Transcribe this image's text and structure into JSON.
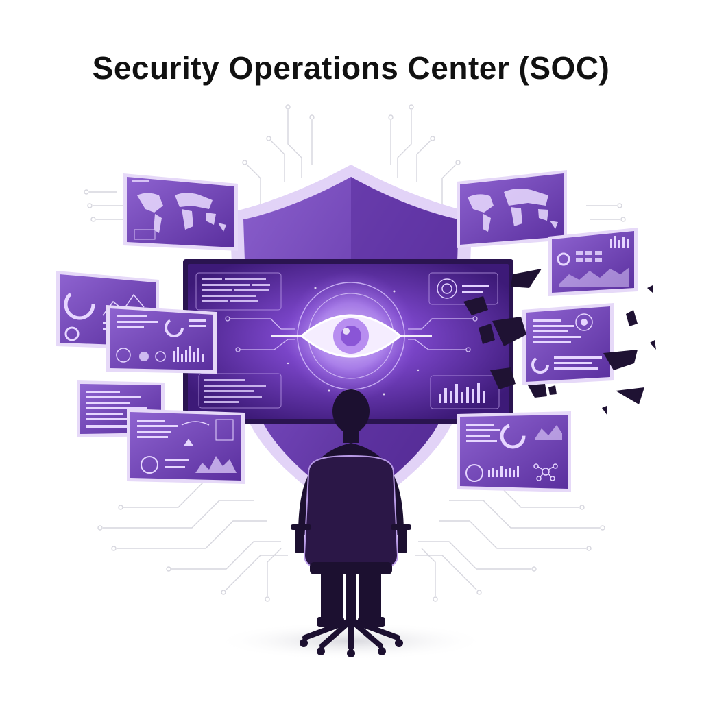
{
  "title": "Security Operations Center (SOC)",
  "colors": {
    "purple_dark": "#3b1a6e",
    "purple_mid": "#6b3fb0",
    "purple_light": "#a77ee0",
    "purple_pale": "#d9c8f2",
    "silhouette": "#1c1030",
    "circuit": "#d4d4dc"
  },
  "icons": {
    "center_eye": "eye-icon",
    "shield": "shield-icon",
    "operator": "person-silhouette-icon",
    "chair": "office-chair-icon",
    "debris": "shattered-fragments-icon"
  }
}
